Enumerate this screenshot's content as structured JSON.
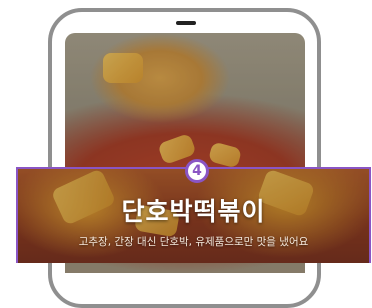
{
  "step": {
    "number": "4",
    "accent_color": "#8a55c4"
  },
  "caption": {
    "title": "단호박떡볶이",
    "subtitle": "고추장, 간장 대신 단호박, 유제품으로만 맛을 냈어요"
  },
  "media": {
    "image_name": "pumpkin-tteokbokki-photo"
  }
}
